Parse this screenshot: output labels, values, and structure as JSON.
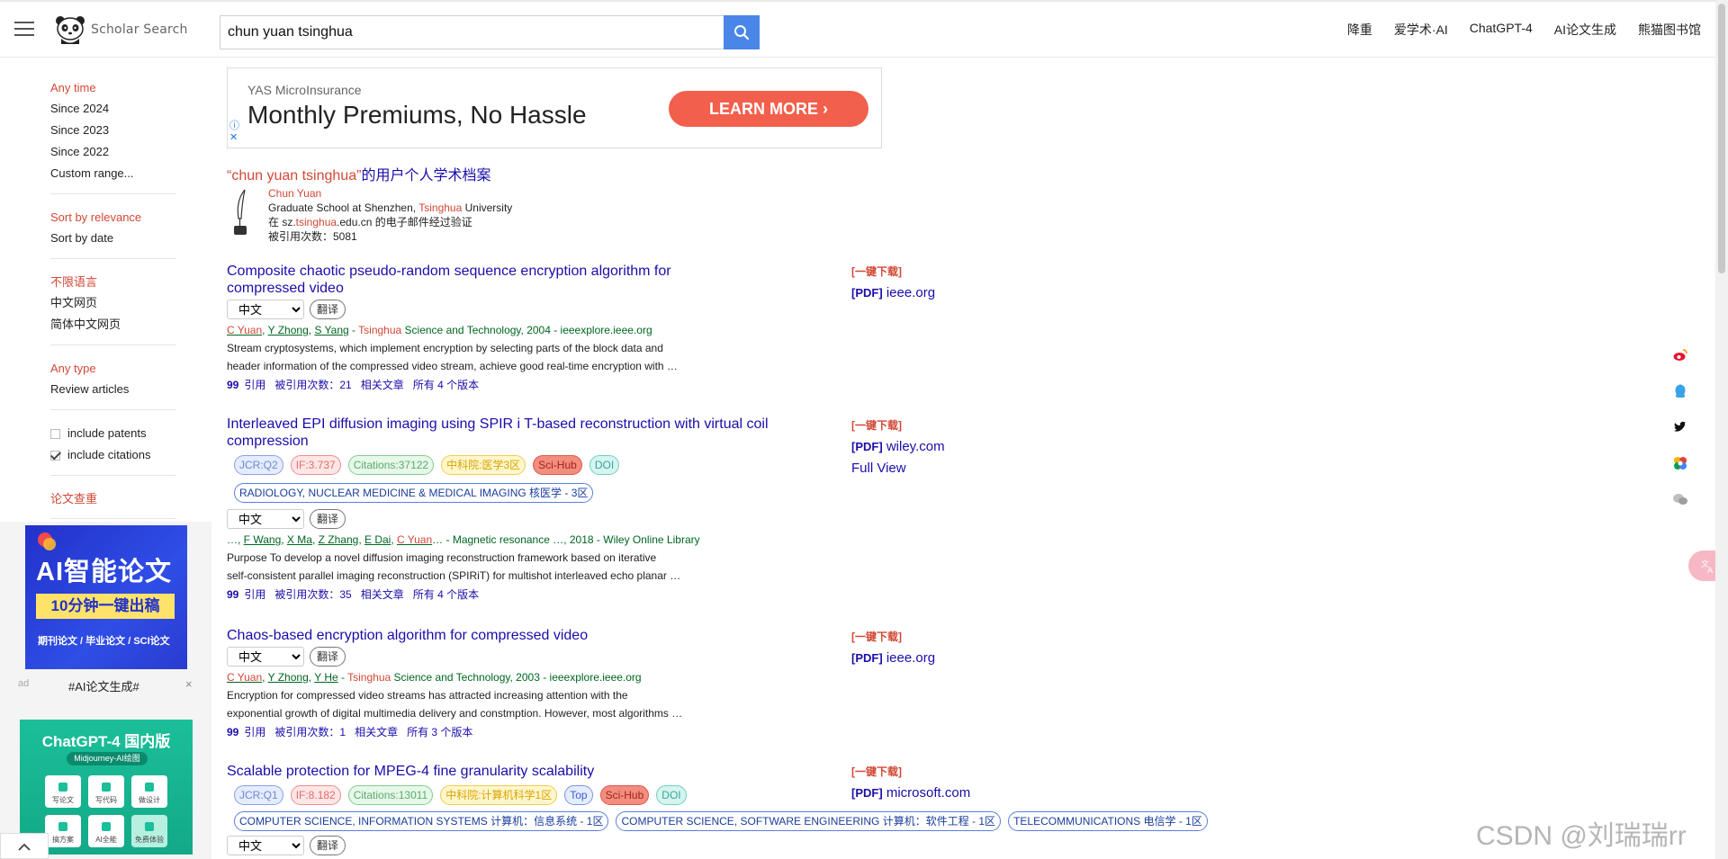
{
  "header": {
    "logo_text": "Scholar Search",
    "search_value": "chun yuan tsinghua",
    "nav": [
      "降重",
      "爱学术·AI",
      "ChatGPT-4",
      "AI论文生成",
      "熊猫图书馆"
    ]
  },
  "sidebar": {
    "time": {
      "head": "Any time",
      "items": [
        "Since 2024",
        "Since 2023",
        "Since 2022",
        "Custom range..."
      ]
    },
    "sort": {
      "head": "Sort by relevance",
      "items": [
        "Sort by date"
      ]
    },
    "language": {
      "head": "不限语言",
      "items": [
        "中文网页",
        "简体中文网页"
      ]
    },
    "type": {
      "head": "Any type",
      "items": [
        "Review articles"
      ]
    },
    "checks": [
      {
        "label": "include patents",
        "checked": false
      },
      {
        "label": "include citations",
        "checked": true
      }
    ],
    "plagiarism": "论文查重"
  },
  "ads": {
    "ad1": {
      "title": "AI智能论文",
      "sub": "10分钟一键出稿",
      "tagline": "期刊论文 / 毕业论文 / SCI论文",
      "tag": "ad",
      "caption": "#AI论文生成#",
      "close": "×"
    },
    "ad2": {
      "title": "ChatGPT-4 国内版",
      "sub": "Midjourney-AI绘图",
      "tiles": [
        "写论文",
        "写代码",
        "做设计",
        "搞方案",
        "AI全能",
        "免费体验"
      ]
    }
  },
  "banner": {
    "brand": "YAS MicroInsurance",
    "headline": "Monthly Premiums, No Hassle",
    "cta": "LEARN MORE"
  },
  "profile": {
    "title_query": "“chun yuan tsinghua”",
    "title_suffix": "的用户个人学术档案",
    "name": "Chun Yuan",
    "affil_pre": "Graduate School at Shenzhen, ",
    "affil_hl": "Tsinghua",
    "affil_post": " University",
    "email_pre": "在 sz.",
    "email_hl": "tsinghua",
    "email_post": ".edu.cn 的电子邮件经过验证",
    "cited": "被引用次数：5081"
  },
  "common": {
    "lang_option": "中文",
    "translate": "翻译",
    "quote_icon": "99",
    "cite": "引用",
    "related": "相关文章",
    "download": "[一键下载]",
    "pdf": "[PDF]"
  },
  "results": [
    {
      "title": "Composite chaotic pseudo-random sequence encryption algorithm for compressed video",
      "meta_authors": [
        "C Yuan",
        "Y Zhong",
        "S Yang"
      ],
      "meta_src_pre": " - ",
      "meta_src_hl": "Tsinghua",
      "meta_src_post": " Science and Technology, 2004 - ieeexplore.ieee.org",
      "snippet1": "Stream cryptosystems, which implement encryption by selecting parts of the block data and",
      "snippet2": "header information of the compressed video stream, achieve good real-time encryption with …",
      "cited_by": "被引用次数：21",
      "versions": "所有 4 个版本",
      "source": "ieee.org",
      "full_view": ""
    },
    {
      "title": "Interleaved EPI diffusion imaging using SPIR i T-based reconstruction with virtual coil compression",
      "badges": [
        "JCR:Q2",
        "IF:3.737",
        "Citations:37122",
        "中科院:医学3区",
        "Sci-Hub",
        "DOI"
      ],
      "categories": [
        "RADIOLOGY, NUCLEAR MEDICINE & MEDICAL IMAGING 核医学 - 3区"
      ],
      "meta_prefix": "…, ",
      "meta_authors": [
        "F Wang",
        "X Ma",
        "Z Zhang",
        "E Dai",
        "C Yuan"
      ],
      "meta_src_post": "… - Magnetic resonance …, 2018 - Wiley Online Library",
      "snippet1": "Purpose To develop a novel diffusion imaging reconstruction framework based on iterative",
      "snippet2": "self-consistent parallel imaging reconstruction (SPIRiT) for multishot interleaved echo planar …",
      "cited_by": "被引用次数：35",
      "versions": "所有 4 个版本",
      "source": "wiley.com",
      "full_view": "Full View"
    },
    {
      "title": "Chaos-based encryption algorithm for compressed video",
      "meta_authors": [
        "C Yuan",
        "Y Zhong",
        "Y He"
      ],
      "meta_src_pre": " - ",
      "meta_src_hl": "Tsinghua",
      "meta_src_post": " Science and Technology, 2003 - ieeexplore.ieee.org",
      "snippet1": "Encryption for compressed video streams has attracted increasing attention with the",
      "snippet2": "exponential growth of digital multimedia delivery and constmption. However, most algorithms …",
      "cited_by": "被引用次数：1",
      "versions": "所有 3 个版本",
      "source": "ieee.org"
    },
    {
      "title": "Scalable protection for MPEG-4 fine granularity scalability",
      "badges": [
        "JCR:Q1",
        "IF:8.182",
        "Citations:13011",
        "中科院:计算机科学1区",
        "Top",
        "Sci-Hub",
        "DOI"
      ],
      "categories": [
        "COMPUTER SCIENCE, INFORMATION SYSTEMS 计算机：信息系统 - 1区",
        "COMPUTER SCIENCE, SOFTWARE ENGINEERING 计算机：软件工程 - 1区",
        "TELECOMMUNICATIONS 电信学 - 1区"
      ],
      "source": "microsoft.com"
    }
  ],
  "watermark": "CSDN @刘瑞瑞rr",
  "colors": {
    "accent_red": "#d14836",
    "link_blue": "#1a0dab",
    "meta_green": "#006621",
    "search_blue": "#4a86e8"
  }
}
